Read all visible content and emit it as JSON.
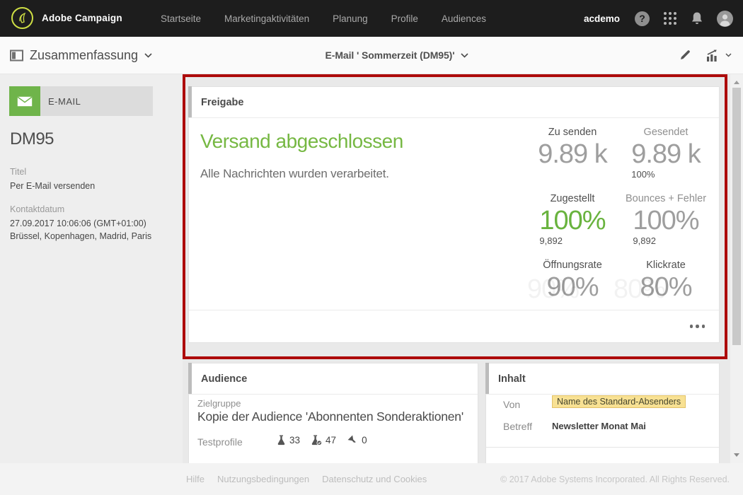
{
  "topbar": {
    "brand": "Adobe Campaign",
    "nav": [
      {
        "label": "Startseite"
      },
      {
        "label": "Marketingaktivitäten"
      },
      {
        "label": "Planung"
      },
      {
        "label": "Profile"
      },
      {
        "label": "Audiences"
      }
    ],
    "username": "acdemo",
    "help_glyph": "?"
  },
  "toolbar": {
    "view_label": "Zusammenfassung",
    "document_title": "E-Mail ' Sommerzeit (DM95)'"
  },
  "sidebar": {
    "type_label": "E-MAIL",
    "code": "DM95",
    "titel_label": "Titel",
    "titel_value": "Per E-Mail versenden",
    "kontakt_label": "Kontaktdatum",
    "kontakt_date": "27.09.2017 10:06:06 (GMT+01:00)",
    "kontakt_cities": "Brüssel, Kopenhagen, Madrid, Paris"
  },
  "delivery_card": {
    "header": "Freigabe",
    "status_title": "Versand abgeschlossen",
    "status_message": "Alle Nachrichten wurden verarbeitet.",
    "stats": [
      {
        "label": "Zu senden",
        "value": "9.89 k",
        "sub": ""
      },
      {
        "label": "Gesendet",
        "value": "9.89 k",
        "sub": "100%"
      },
      {
        "label": "Zugestellt",
        "value": "100%",
        "sub": "9,892"
      },
      {
        "label": "Bounces + Fehler",
        "value": "100%",
        "sub": "9,892"
      },
      {
        "label": "Öffnungsrate",
        "value": "90%",
        "sub": ""
      },
      {
        "label": "Klickrate",
        "value": "80%",
        "sub": ""
      }
    ],
    "more_icon": "ellipsis"
  },
  "audience_card": {
    "header": "Audience",
    "target_label": "Zielgruppe",
    "target_value": "Kopie der Audience 'Abonnenten Sonderaktionen'",
    "testprofiles_label": "Testprofile",
    "counters": [
      {
        "icon": "flask",
        "value": "33"
      },
      {
        "icon": "flask-check",
        "value": "47"
      },
      {
        "icon": "funnel",
        "value": "0"
      }
    ]
  },
  "content_card": {
    "header": "Inhalt",
    "rows": [
      {
        "label": "Von",
        "value": "Name des Standard-Absenders"
      },
      {
        "label": "Betreff",
        "value": "Newsletter Monat Mai"
      }
    ]
  },
  "footer": {
    "links": [
      {
        "label": "Hilfe"
      },
      {
        "label": "Nutzungsbedingungen"
      },
      {
        "label": "Datenschutz und Cookies"
      }
    ],
    "copyright": "© 2017 Adobe Systems Incorporated. All Rights Reserved."
  },
  "colors": {
    "green": "#76b843",
    "annotation_red": "#ad0b0b",
    "highlight_yellow": "#f8e193",
    "topbar_bg": "#1d1d1d"
  }
}
